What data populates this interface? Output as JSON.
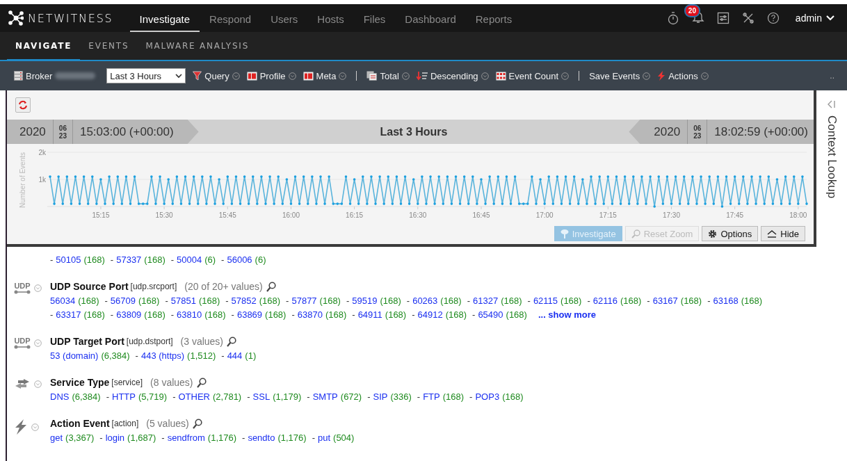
{
  "top_nav": {
    "brand": "NETWITNESS",
    "tabs": [
      {
        "label": "Investigate",
        "selected": true
      },
      {
        "label": "Respond",
        "selected": false
      },
      {
        "label": "Users",
        "selected": false
      },
      {
        "label": "Hosts",
        "selected": false
      },
      {
        "label": "Files",
        "selected": false
      },
      {
        "label": "Dashboard",
        "selected": false
      },
      {
        "label": "Reports",
        "selected": false
      }
    ],
    "notification_count": "20",
    "user": "admin"
  },
  "sub_nav": [
    {
      "label": "NAVIGATE",
      "selected": true
    },
    {
      "label": "EVENTS",
      "selected": false
    },
    {
      "label": "MALWARE ANALYSIS",
      "selected": false
    }
  ],
  "toolbar": {
    "items": [
      {
        "kind": "broker",
        "label": "Broker"
      },
      {
        "kind": "select",
        "value": "Last 3 Hours"
      },
      {
        "kind": "menu",
        "label": "Query"
      },
      {
        "kind": "menu",
        "label": "Profile"
      },
      {
        "kind": "menu",
        "label": "Meta"
      },
      {
        "kind": "separator"
      },
      {
        "kind": "menu",
        "label": "Total"
      },
      {
        "kind": "menu",
        "label": "Descending"
      },
      {
        "kind": "menu",
        "label": "Event Count"
      },
      {
        "kind": "separator"
      },
      {
        "kind": "menu",
        "label": "Save Events"
      },
      {
        "kind": "menu",
        "label": "Actions"
      }
    ],
    "overflow": ".."
  },
  "time_range": {
    "start": {
      "year": "2020",
      "month": "06",
      "day": "23",
      "time": "15:03:00 (+00:00)"
    },
    "title": "Last 3 Hours",
    "end": {
      "year": "2020",
      "month": "06",
      "day": "23",
      "time": "18:02:59 (+00:00)"
    }
  },
  "chart": {
    "chart_data": {
      "type": "line",
      "ylabel": "Number of Events",
      "ylim": [
        0,
        2000
      ],
      "yticks": [
        {
          "value": 1000,
          "label": "1k"
        },
        {
          "value": 2000,
          "label": "2k"
        }
      ],
      "categories": [
        null,
        null,
        null,
        null,
        null,
        null,
        null,
        null,
        null,
        null,
        null,
        null,
        "15:15",
        null,
        null,
        null,
        null,
        null,
        null,
        null,
        null,
        null,
        null,
        null,
        null,
        null,
        null,
        "15:30",
        null,
        null,
        null,
        null,
        null,
        null,
        null,
        null,
        null,
        null,
        null,
        null,
        null,
        null,
        "15:45",
        null,
        null,
        null,
        null,
        null,
        null,
        null,
        null,
        null,
        null,
        null,
        null,
        null,
        null,
        "16:00",
        null,
        null,
        null,
        null,
        null,
        null,
        null,
        null,
        null,
        null,
        null,
        null,
        null,
        null,
        "16:15",
        null,
        null,
        null,
        null,
        null,
        null,
        null,
        null,
        null,
        null,
        null,
        null,
        null,
        null,
        "16:30",
        null,
        null,
        null,
        null,
        null,
        null,
        null,
        null,
        null,
        null,
        null,
        null,
        null,
        null,
        "16:45",
        null,
        null,
        null,
        null,
        null,
        null,
        null,
        null,
        null,
        null,
        null,
        null,
        null,
        null,
        "17:00",
        null,
        null,
        null,
        null,
        null,
        null,
        null,
        null,
        null,
        null,
        null,
        null,
        null,
        null,
        "17:15",
        null,
        null,
        null,
        null,
        null,
        null,
        null,
        null,
        null,
        null,
        null,
        null,
        null,
        null,
        "17:30",
        null,
        null,
        null,
        null,
        null,
        null,
        null,
        null,
        null,
        null,
        null,
        null,
        null,
        null,
        "17:45",
        null,
        null,
        null,
        null,
        null,
        null,
        null,
        null,
        null,
        null,
        null,
        null,
        null,
        null,
        "18:00",
        null,
        null
      ],
      "series": [
        {
          "color": "#5ab4dc",
          "values": [
            1100,
            100,
            1100,
            100,
            1100,
            100,
            1100,
            100,
            1100,
            100,
            1100,
            100,
            1000,
            100,
            1100,
            100,
            1100,
            100,
            1100,
            100,
            1100,
            100,
            100,
            100,
            1100,
            100,
            1100,
            100,
            1000,
            100,
            1100,
            100,
            1100,
            100,
            1100,
            100,
            1100,
            100,
            1100,
            100,
            1000,
            100,
            1100,
            100,
            1100,
            100,
            1100,
            100,
            1100,
            100,
            1100,
            100,
            1100,
            100,
            1100,
            100,
            1000,
            100,
            1100,
            100,
            1100,
            100,
            1100,
            100,
            1100,
            100,
            1100,
            100,
            100,
            100,
            1100,
            100,
            1000,
            100,
            1100,
            100,
            1100,
            100,
            1100,
            100,
            1100,
            100,
            1100,
            100,
            1100,
            100,
            1000,
            100,
            1100,
            100,
            1100,
            100,
            1100,
            100,
            1100,
            100,
            1100,
            100,
            1100,
            100,
            1100,
            100,
            1000,
            100,
            1100,
            100,
            1100,
            100,
            1100,
            100,
            1100,
            100,
            100,
            100,
            1100,
            100,
            1000,
            100,
            1100,
            100,
            1100,
            100,
            1100,
            100,
            1100,
            100,
            1000,
            100,
            1100,
            100,
            1100,
            100,
            1100,
            100,
            1100,
            100,
            1100,
            100,
            1100,
            100,
            1100,
            100,
            1100,
            0,
            1100,
            100,
            1100,
            100,
            1100,
            100,
            1100,
            100,
            1100,
            100,
            1100,
            100,
            1100,
            100,
            1100,
            0,
            1100,
            100,
            1100,
            100,
            1100,
            100,
            1100,
            100,
            1100,
            100,
            1100,
            100,
            1000,
            100,
            1100,
            100,
            1100,
            100,
            1100,
            100
          ]
        }
      ]
    }
  },
  "chart_buttons": [
    {
      "label": "Investigate",
      "disabled": true
    },
    {
      "label": "Reset Zoom",
      "disabled": true
    },
    {
      "label": "Options",
      "disabled": false
    },
    {
      "label": "Hide",
      "disabled": false
    }
  ],
  "context_panel": {
    "title": "Context Lookup"
  },
  "meta_groups": [
    {
      "kind": "partial",
      "values": [
        {
          "dash": "-",
          "value": "50105",
          "count": "(168)"
        },
        {
          "dash": "-",
          "value": "57337",
          "count": "(168)"
        },
        {
          "dash": "-",
          "value": "50004",
          "count": "(6)"
        },
        {
          "dash": "-",
          "value": "56006",
          "count": "(6)"
        }
      ]
    },
    {
      "kind": "udp",
      "icon_label": "UDP",
      "title": "UDP Source Port",
      "key": "[udp.srcport]",
      "summary": "(20 of 20+ values)",
      "values": [
        {
          "value": "56034",
          "count": "(168)"
        },
        {
          "dash": "-",
          "value": "56709",
          "count": "(168)"
        },
        {
          "dash": "-",
          "value": "57851",
          "count": "(168)"
        },
        {
          "dash": "-",
          "value": "57852",
          "count": "(168)"
        },
        {
          "dash": "-",
          "value": "57877",
          "count": "(168)"
        },
        {
          "dash": "-",
          "value": "59519",
          "count": "(168)"
        },
        {
          "dash": "-",
          "value": "60263",
          "count": "(168)"
        },
        {
          "dash": "-",
          "value": "61327",
          "count": "(168)"
        },
        {
          "dash": "-",
          "value": "62115",
          "count": "(168)"
        },
        {
          "dash": "-",
          "value": "62116",
          "count": "(168)"
        },
        {
          "dash": "-",
          "value": "63167",
          "count": "(168)"
        },
        {
          "dash": "-",
          "value": "63168",
          "count": "(168)"
        },
        {
          "dash": "-",
          "value": "63317",
          "count": "(168)"
        },
        {
          "dash": "-",
          "value": "63809",
          "count": "(168)"
        },
        {
          "dash": "-",
          "value": "63810",
          "count": "(168)"
        },
        {
          "dash": "-",
          "value": "63869",
          "count": "(168)"
        },
        {
          "dash": "-",
          "value": "63870",
          "count": "(168)"
        },
        {
          "dash": "-",
          "value": "64911",
          "count": "(168)"
        },
        {
          "dash": "-",
          "value": "64912",
          "count": "(168)"
        },
        {
          "dash": "-",
          "value": "65490",
          "count": "(168)"
        }
      ],
      "show_more": "... show more"
    },
    {
      "kind": "udp",
      "icon_label": "UDP",
      "title": "UDP Target Port",
      "key": "[udp.dstport]",
      "summary": "(3 values)",
      "values": [
        {
          "value": "53 (domain)",
          "count": "(6,384)"
        },
        {
          "dash": "-",
          "value": "443 (https)",
          "count": "(1,512)"
        },
        {
          "dash": "-",
          "value": "444",
          "count": "(1)"
        }
      ]
    },
    {
      "kind": "service",
      "title": "Service Type",
      "key": "[service]",
      "summary": "(8 values)",
      "values": [
        {
          "value": "DNS",
          "count": "(6,384)"
        },
        {
          "dash": "-",
          "value": "HTTP",
          "count": "(5,719)"
        },
        {
          "dash": "-",
          "value": "OTHER",
          "count": "(2,781)"
        },
        {
          "dash": "-",
          "value": "SSL",
          "count": "(1,179)"
        },
        {
          "dash": "-",
          "value": "SMTP",
          "count": "(672)"
        },
        {
          "dash": "-",
          "value": "SIP",
          "count": "(336)"
        },
        {
          "dash": "-",
          "value": "FTP",
          "count": "(168)"
        },
        {
          "dash": "-",
          "value": "POP3",
          "count": "(168)"
        }
      ]
    },
    {
      "kind": "action",
      "title": "Action Event",
      "key": "[action]",
      "summary": "(5 values)",
      "values": [
        {
          "value": "get",
          "count": "(3,367)"
        },
        {
          "dash": "-",
          "value": "login",
          "count": "(1,687)"
        },
        {
          "dash": "-",
          "value": "sendfrom",
          "count": "(1,176)"
        },
        {
          "dash": "-",
          "value": "sendto",
          "count": "(1,176)"
        },
        {
          "dash": "-",
          "value": "put",
          "count": "(504)"
        }
      ]
    }
  ]
}
